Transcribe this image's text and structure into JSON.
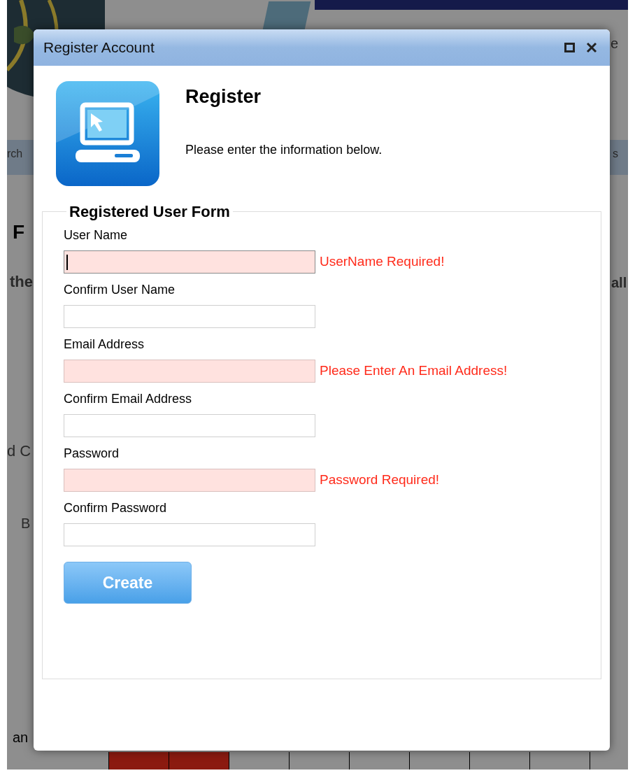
{
  "background": {
    "fragments": [
      "e",
      "rch",
      "s",
      "F",
      "the",
      "all",
      "d C",
      "B",
      "an"
    ],
    "tabs": [
      {
        "selected": true
      },
      {
        "selected": true
      },
      {
        "selected": false
      },
      {
        "selected": false
      },
      {
        "selected": false
      },
      {
        "selected": false
      },
      {
        "selected": false
      },
      {
        "selected": false
      },
      {
        "selected": false
      }
    ]
  },
  "dialog": {
    "title": "Register Account",
    "heading": "Register",
    "subtitle": "Please enter the information below.",
    "form": {
      "legend": "Registered User Form",
      "fields": [
        {
          "label": "User Name",
          "invalid": true,
          "focused": true,
          "error": "UserName Required!"
        },
        {
          "label": "Confirm User Name",
          "invalid": false,
          "focused": false
        },
        {
          "label": "Email Address",
          "invalid": true,
          "focused": false,
          "error": "Please Enter An Email Address!"
        },
        {
          "label": "Confirm Email Address",
          "invalid": false,
          "focused": false
        },
        {
          "label": "Password",
          "invalid": true,
          "focused": false,
          "error": "Password Required!"
        },
        {
          "label": "Confirm Password",
          "invalid": false,
          "focused": false
        }
      ],
      "submit": "Create"
    }
  }
}
